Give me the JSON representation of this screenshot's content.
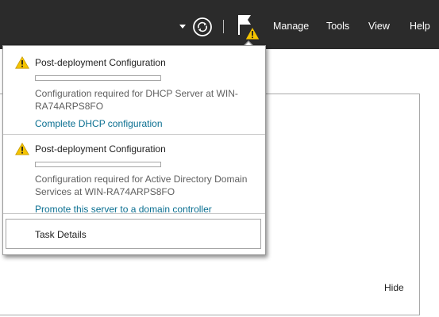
{
  "topbar": {
    "menu": [
      {
        "label": "Manage"
      },
      {
        "label": "Tools"
      },
      {
        "label": "View"
      },
      {
        "label": "Help"
      }
    ],
    "icons": [
      "dropdown-arrow-icon",
      "refresh-icon",
      "flag-icon",
      "warning-icon"
    ]
  },
  "notifications": [
    {
      "title": "Post-deployment Configuration",
      "progress": 0,
      "description": "Configuration required for DHCP Server at WIN-RA74ARPS8FO",
      "action": "Complete DHCP configuration"
    },
    {
      "title": "Post-deployment Configuration",
      "progress": 0,
      "description": "Configuration required for Active Directory Domain Services at WIN-RA74ARPS8FO",
      "action": "Promote this server to a domain controller"
    }
  ],
  "task_details": {
    "label": "Task Details"
  },
  "background": {
    "hide_label": "Hide"
  },
  "colors": {
    "topbar": "#2b2b2b",
    "link": "#0a6f91",
    "warning": "#f5c400"
  }
}
